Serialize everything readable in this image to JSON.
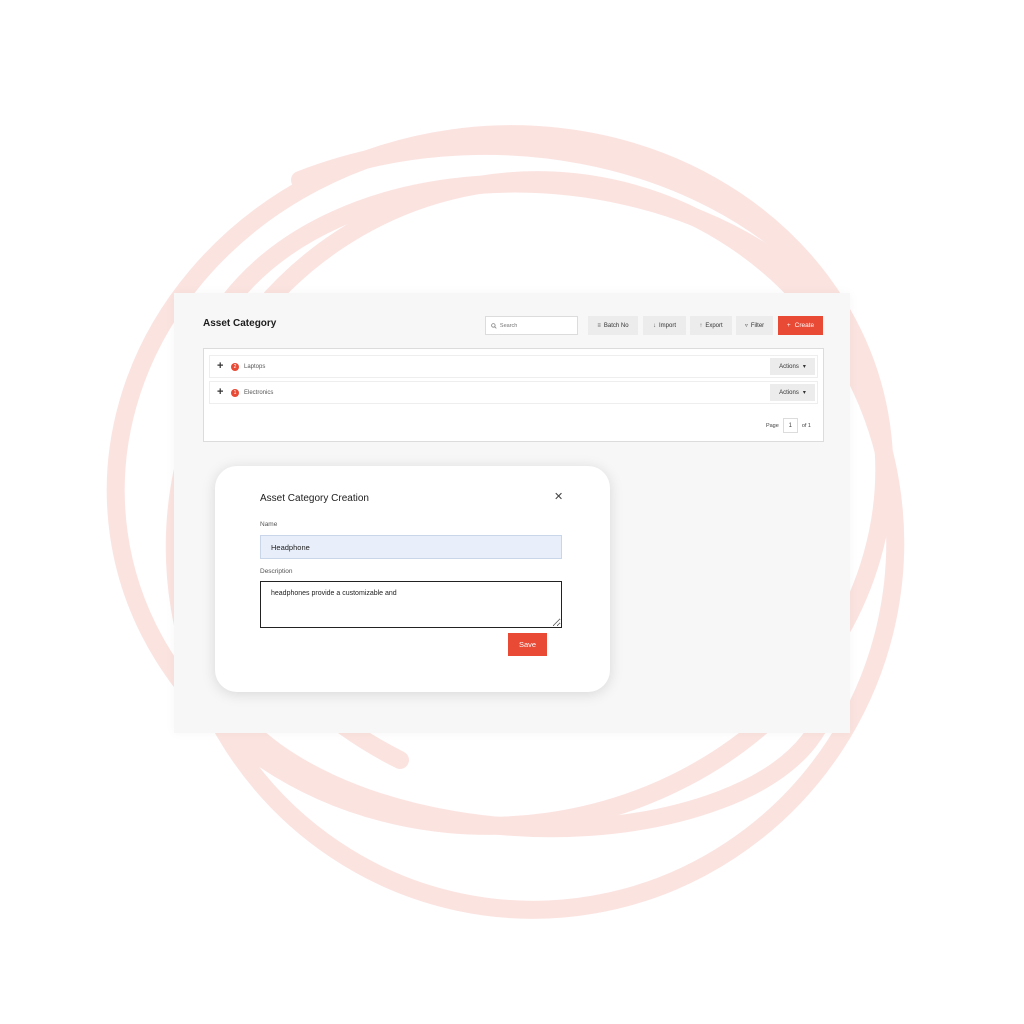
{
  "page": {
    "title": "Asset Category"
  },
  "toolbar": {
    "search_placeholder": "Search",
    "batch_no_label": "Batch No",
    "import_label": "Import",
    "export_label": "Export",
    "filter_label": "Filter",
    "create_label": "Create"
  },
  "categories": [
    {
      "name": "Laptops",
      "count": "2",
      "actions_label": "Actions"
    },
    {
      "name": "Electronics",
      "count": "1",
      "actions_label": "Actions"
    }
  ],
  "pagination": {
    "page_label": "Page",
    "current_page": "1",
    "of_label": "of 1"
  },
  "modal": {
    "title": "Asset Category Creation",
    "name_label": "Name",
    "name_value": "Headphone",
    "description_label": "Description",
    "description_value": "headphones provide a customizable and",
    "save_label": "Save"
  },
  "colors": {
    "accent": "#e94a35",
    "swirl": "#fbe3e0",
    "name_field_bg": "#e8effb"
  },
  "icons": {
    "search": "search-icon",
    "batch_no": "list-icon",
    "import": "arrow-down-icon",
    "export": "arrow-up-icon",
    "filter": "filter-icon",
    "create": "plus-icon",
    "expand": "plus-icon",
    "actions": "caret-down-icon",
    "close": "close-icon"
  }
}
